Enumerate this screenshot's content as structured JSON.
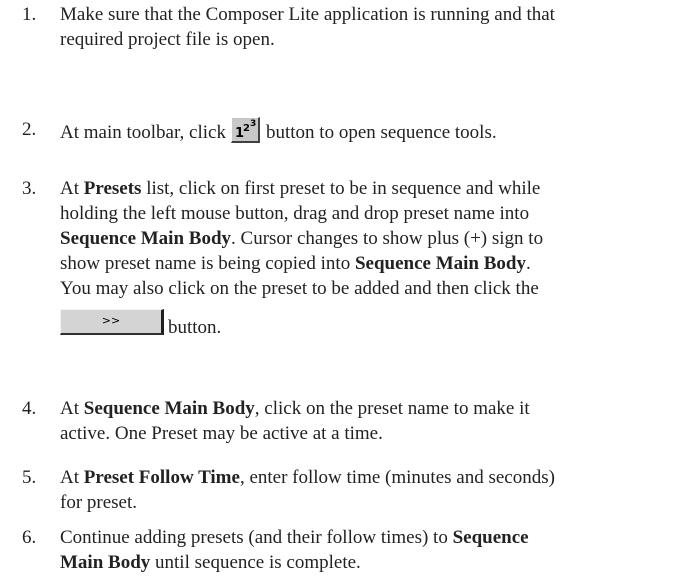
{
  "steps": [
    {
      "num": "1.",
      "line1": "Make sure that the Composer Lite application is running and that",
      "line2": "required project file is open."
    },
    {
      "num": "2.",
      "before_icon": "At main toolbar, click",
      "icon_name": "sequence-tools-icon",
      "icon_glyph": "123",
      "after_icon": "button to open sequence tools."
    },
    {
      "num": "3.",
      "l1_a": "At ",
      "l1_b": "Presets",
      "l1_c": " list, click on first preset to be in sequence and while",
      "l2": "holding the left mouse button, drag and drop preset name into",
      "l3_b": "Sequence Main Body",
      "l3_c": ". Cursor changes to show plus (+) sign to",
      "l4_a": "show preset name is being copied into ",
      "l4_b": "Sequence Main Body",
      "l4_c": ".",
      "l5": "You may also click on the preset to be added and then click the",
      "button_label": ">>",
      "after_button": "button."
    },
    {
      "num": "4.",
      "l1_a": "At ",
      "l1_b": "Sequence Main Body",
      "l1_c": ", click on the preset name to make it",
      "l2": "active. One Preset may be active at a time."
    },
    {
      "num": "5.",
      "l1_a": "At ",
      "l1_b": "Preset Follow Time",
      "l1_c": ", enter follow time (minutes and seconds)",
      "l2": "for preset."
    },
    {
      "num": "6.",
      "l1_a": "Continue adding presets (and their follow times) to ",
      "l1_b": "Sequence",
      "l2_b": "Main Body",
      "l2_c": " until sequence is complete."
    }
  ]
}
